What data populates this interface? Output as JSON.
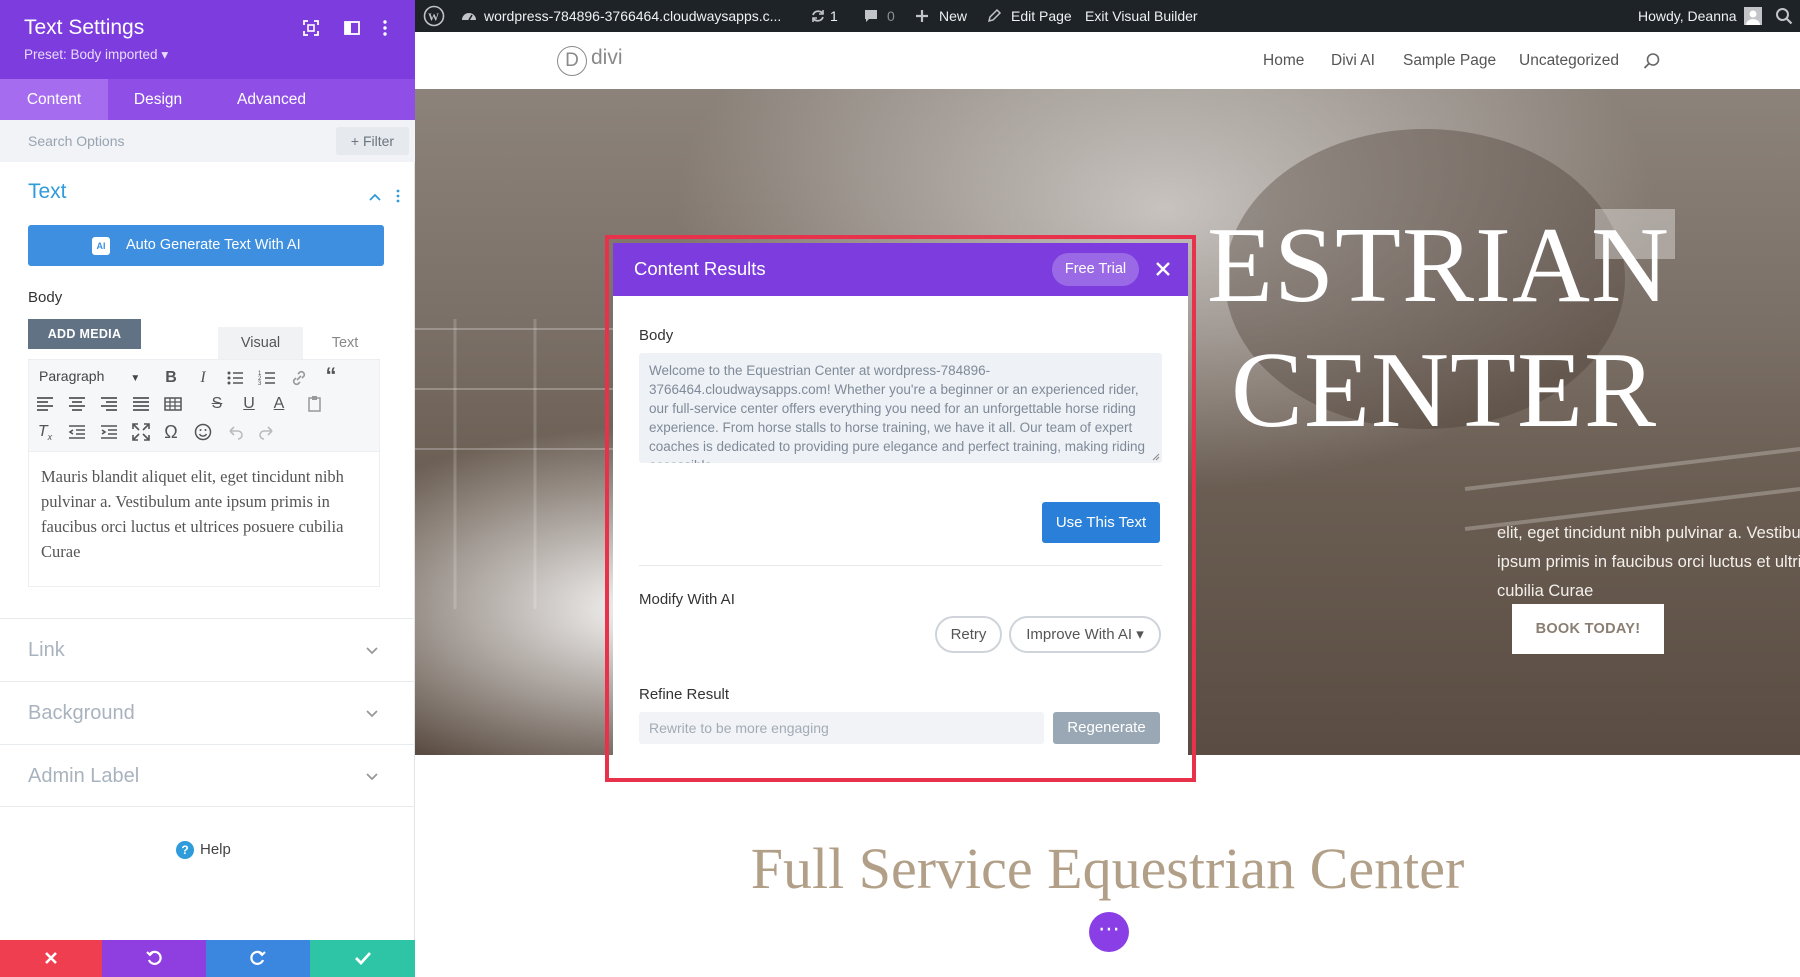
{
  "panel": {
    "title": "Text Settings",
    "preset": "Preset: Body imported ▾",
    "tabs": [
      "Content",
      "Design",
      "Advanced"
    ],
    "search_placeholder": "Search Options",
    "filter_label": "+ Filter",
    "section_title": "Text",
    "ai_button_label": "Auto Generate Text With AI",
    "ai_badge": "AI",
    "body_label": "Body",
    "add_media_label": "ADD MEDIA",
    "editor_tabs": {
      "visual": "Visual",
      "text": "Text"
    },
    "paragraph_select": "Paragraph",
    "editor_content": "Mauris blandit aliquet elit, eget tincidunt nibh pulvinar a. Vestibulum ante ipsum primis in faucibus orci luctus et ultrices posuere cubilia Curae",
    "accordions": [
      "Link",
      "Background",
      "Admin Label"
    ],
    "help_label": "Help"
  },
  "adminbar": {
    "site": "wordpress-784896-3766464.cloudwaysapps.c...",
    "updates": "1",
    "comments": "0",
    "new_label": "New",
    "edit_page": "Edit Page",
    "exit_builder": "Exit Visual Builder",
    "howdy": "Howdy, Deanna"
  },
  "site": {
    "logo_text": "divi",
    "logo_mark": "D",
    "nav": [
      "Home",
      "Divi AI",
      "Sample Page",
      "Uncategorized"
    ]
  },
  "hero": {
    "line1": "ESTRIAN",
    "line2": "CENTER",
    "subtitle": "elit, eget tincidunt nibh pulvinar a. Vestibulum ante ipsum primis in faucibus orci luctus et ultrices posuere cubilia Curae",
    "cta": "BOOK TODAY!"
  },
  "below": {
    "heading": "Full Service Equestrian Center",
    "fab": "⋯"
  },
  "modal": {
    "title": "Content Results",
    "free_trial": "Free Trial",
    "body_label": "Body",
    "body_text": "Welcome to the Equestrian Center at wordpress-784896-3766464.cloudwaysapps.com! Whether you're a beginner or an experienced rider, our full-service center offers everything you need for an unforgettable horse riding experience. From horse stalls to horse training, we have it all. Our team of expert coaches is dedicated to providing pure elegance and perfect training, making riding accessible",
    "use_text": "Use This Text",
    "modify_label": "Modify With AI",
    "retry": "Retry",
    "improve": "Improve With AI ▾",
    "refine_label": "Refine Result",
    "refine_placeholder": "Rewrite to be more engaging",
    "regenerate": "Regenerate"
  },
  "colors": {
    "purple": "#7d3cde",
    "accent_blue": "#2e9bda",
    "highlight_red": "#e8314a",
    "discard": "#ef3e50",
    "undo": "#8f3fe0",
    "redo": "#3b86df",
    "save": "#2ec4a6"
  }
}
